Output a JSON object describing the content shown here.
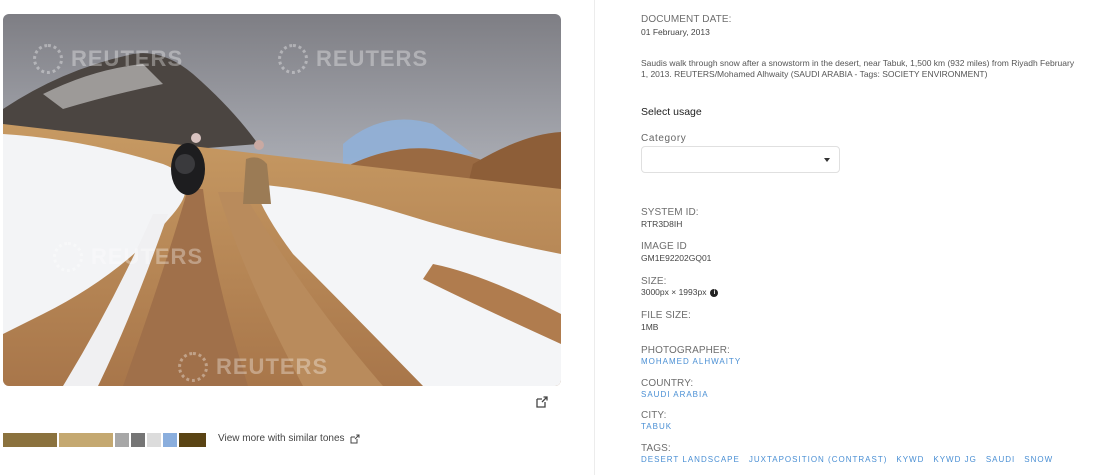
{
  "watermark": {
    "text": "REUTERS"
  },
  "colors": {
    "link": "#4a8fd4",
    "swatches": [
      "#8b723e",
      "#c4a870",
      "#a7a7a7",
      "#757575",
      "#dcdcdc",
      "#8aaedd",
      "#5a4414"
    ]
  },
  "swatch_weights": [
    55,
    55,
    14,
    14,
    14,
    14,
    28
  ],
  "similar_tones_label": "View more with similar tones",
  "details": {
    "document_date_label": "DOCUMENT DATE:",
    "document_date": "01 February, 2013",
    "caption": "Saudis walk through snow after a snowstorm in the desert, near Tabuk, 1,500 km (932 miles) from Riyadh February 1, 2013. REUTERS/Mohamed Alhwaity (SAUDI ARABIA - Tags: SOCIETY ENVIRONMENT)",
    "select_usage": "Select usage",
    "category_label": "Category",
    "category_value": "",
    "system_id_label": "SYSTEM ID:",
    "system_id": "RTR3D8IH",
    "image_id_label": "IMAGE ID",
    "image_id": "GM1E92202GQ01",
    "size_label": "SIZE:",
    "size": "3000px × 1993px",
    "file_size_label": "FILE SIZE:",
    "file_size": "1MB",
    "photographer_label": "PHOTOGRAPHER:",
    "photographer": "MOHAMED ALHWAITY",
    "country_label": "COUNTRY:",
    "country": "SAUDI ARABIA",
    "city_label": "CITY:",
    "city": "TABUK",
    "tags_label": "TAGS:",
    "tags": [
      "DESERT LANDSCAPE",
      "JUXTAPOSITION (CONTRAST)",
      "KYWD",
      "KYWD JG",
      "SAUDI",
      "SNOW"
    ]
  }
}
